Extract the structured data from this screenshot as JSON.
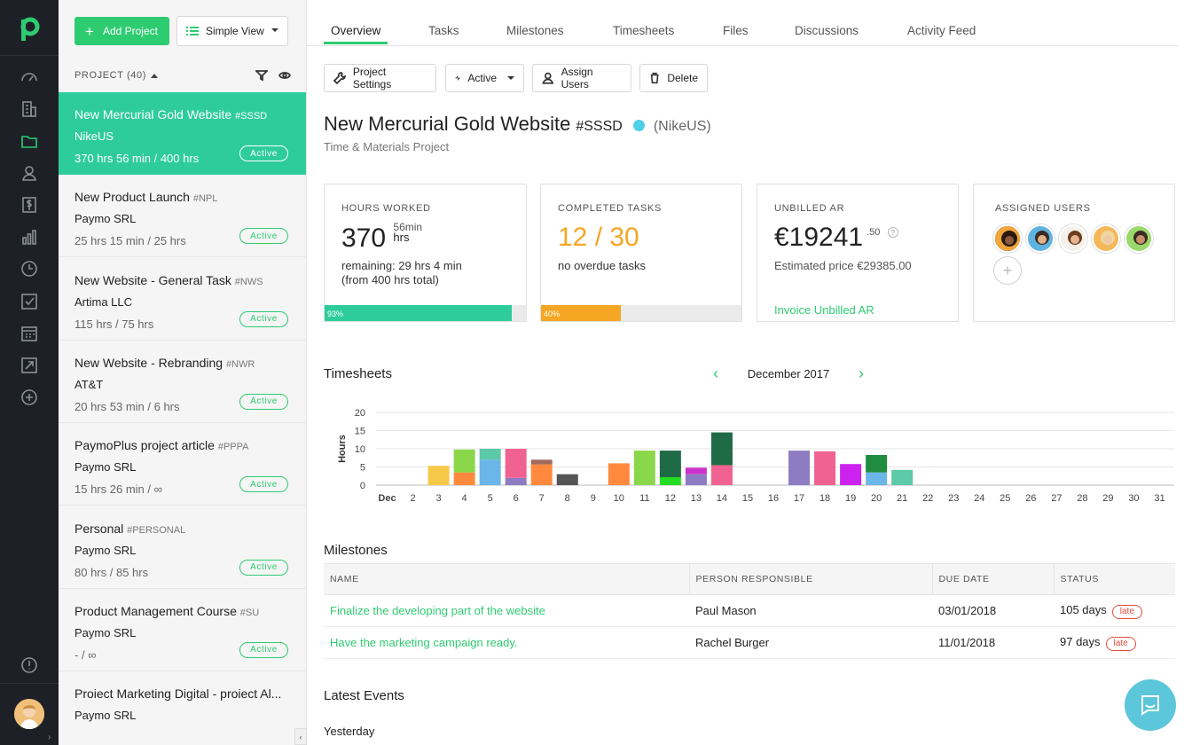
{
  "sidebar": {
    "icons": [
      "dashboard-icon",
      "clients-icon",
      "projects-icon",
      "users-icon",
      "invoices-icon",
      "reports-icon",
      "time-icon",
      "tasks-icon",
      "calendar-icon",
      "leads-icon",
      "add-icon",
      "help-icon"
    ]
  },
  "plist": {
    "add_label": "Add Project",
    "view_label": "Simple View",
    "header": "PROJECT (40)",
    "projects": [
      {
        "name": "New Mercurial Gold Website",
        "code": "#SSSD",
        "client": "NikeUS",
        "hours": "370 hrs 56 min / 400 hrs",
        "status": "Active"
      },
      {
        "name": "New Product Launch",
        "code": "#NPL",
        "client": "Paymo SRL",
        "hours": "25 hrs 15 min / 25 hrs",
        "status": "Active"
      },
      {
        "name": "New Website - General Task",
        "code": "#NWS",
        "client": "Artima LLC",
        "hours": "115 hrs / 75 hrs",
        "status": "Active"
      },
      {
        "name": "New Website - Rebranding",
        "code": "#NWR",
        "client": "AT&T",
        "hours": "20 hrs 53 min / 6 hrs",
        "status": "Active"
      },
      {
        "name": "PaymoPlus project article",
        "code": "#PPPA",
        "client": "Paymo SRL",
        "hours": "15 hrs 26 min / ∞",
        "status": "Active"
      },
      {
        "name": "Personal",
        "code": "#PERSONAL",
        "client": "Paymo SRL",
        "hours": "80 hrs / 85 hrs",
        "status": "Active"
      },
      {
        "name": "Product Management Course",
        "code": "#SU",
        "client": "Paymo SRL",
        "hours": "- / ∞",
        "status": "Active"
      },
      {
        "name": "Proiect Marketing Digital - proiect Al...",
        "code": "",
        "client": "Paymo SRL",
        "hours": "",
        "status": ""
      }
    ]
  },
  "tabs": [
    "Overview",
    "Tasks",
    "Milestones",
    "Timesheets",
    "Files",
    "Discussions",
    "Activity Feed"
  ],
  "toolbar": {
    "settings": "Project Settings",
    "status": "Active",
    "assign": "Assign Users",
    "delete": "Delete"
  },
  "project": {
    "title": "New Mercurial Gold Website",
    "code": "#SSSD",
    "client": "(NikeUS)",
    "type": "Time & Materials Project",
    "dot_color": "#4dd0e8"
  },
  "cards": {
    "hours": {
      "title": "HOURS WORKED",
      "value": "370",
      "unit_top": "56min",
      "unit_bottom": "hrs",
      "remaining": "remaining: 29 hrs 4 min",
      "total": "(from 400 hrs total)",
      "progress_label": "93%",
      "progress": 0.93,
      "color": "#2ecc9b"
    },
    "tasks": {
      "title": "COMPLETED TASKS",
      "value": "12 / 30",
      "note": "no overdue tasks",
      "progress_label": "40%",
      "progress": 0.4,
      "color": "#f5a623"
    },
    "ar": {
      "title": "UNBILLED AR",
      "value": "€19241",
      "cents": ".50",
      "estimate": "Estimated price €29385.00",
      "link": "Invoice Unbilled AR"
    },
    "users": {
      "title": "ASSIGNED USERS",
      "add": "+"
    }
  },
  "timesheets": {
    "title": "Timesheets",
    "month": "December 2017",
    "prev": "‹",
    "next": "›"
  },
  "chart_data": {
    "type": "bar",
    "stacked": true,
    "ylabel": "Hours",
    "ylim": [
      0,
      20
    ],
    "yticks": [
      0,
      5,
      10,
      15,
      20
    ],
    "categories": [
      "Dec",
      "2",
      "3",
      "4",
      "5",
      "6",
      "7",
      "8",
      "9",
      "10",
      "11",
      "12",
      "13",
      "14",
      "15",
      "16",
      "17",
      "18",
      "19",
      "20",
      "21",
      "22",
      "23",
      "24",
      "25",
      "26",
      "27",
      "28",
      "29",
      "30",
      "31"
    ],
    "stacks": [
      [],
      [],
      [
        {
          "v": 5.3,
          "c": "#f7c948"
        }
      ],
      [
        {
          "v": 3.5,
          "c": "#ff8a3d"
        },
        {
          "v": 6.3,
          "c": "#8bd74a"
        }
      ],
      [
        {
          "v": 7,
          "c": "#6bb6e8"
        },
        {
          "v": 3,
          "c": "#5cc9a7"
        }
      ],
      [
        {
          "v": 2,
          "c": "#8e7cc3"
        },
        {
          "v": 8,
          "c": "#f06292"
        }
      ],
      [
        {
          "v": 5.7,
          "c": "#ff8a3d"
        },
        {
          "v": 1.3,
          "c": "#a06a5a"
        }
      ],
      [
        {
          "v": 3,
          "c": "#555555"
        }
      ],
      [],
      [
        {
          "v": 6,
          "c": "#ff8a3d"
        }
      ],
      [
        {
          "v": 9.5,
          "c": "#8bd74a"
        }
      ],
      [
        {
          "v": 2.2,
          "c": "#22dd22"
        },
        {
          "v": 7.3,
          "c": "#1f6b45"
        }
      ],
      [
        {
          "v": 3,
          "c": "#8e7cc3"
        },
        {
          "v": 1.8,
          "c": "#cc33cc"
        }
      ],
      [
        {
          "v": 5.5,
          "c": "#f06292"
        },
        {
          "v": 9,
          "c": "#1f6b45"
        }
      ],
      [],
      [],
      [
        {
          "v": 9.5,
          "c": "#8e7cc3"
        }
      ],
      [
        {
          "v": 9.3,
          "c": "#f06292"
        }
      ],
      [
        {
          "v": 5.8,
          "c": "#cc22ee"
        }
      ],
      [
        {
          "v": 3.5,
          "c": "#6bb6e8"
        },
        {
          "v": 4.8,
          "c": "#1f8c3f"
        }
      ],
      [
        {
          "v": 4.2,
          "c": "#5cc9a7"
        }
      ],
      [],
      [],
      [],
      [],
      [],
      [],
      [],
      [],
      [],
      []
    ]
  },
  "milestones": {
    "title": "Milestones",
    "columns": [
      "NAME",
      "PERSON RESPONSIBLE",
      "DUE DATE",
      "STATUS"
    ],
    "rows": [
      {
        "name": "Finalize the developing part of the website",
        "person": "Paul Mason",
        "due": "03/01/2018",
        "days": "105 days",
        "status": "late"
      },
      {
        "name": "Have the marketing campaign ready.",
        "person": "Rachel Burger",
        "due": "11/01/2018",
        "days": "97 days",
        "status": "late"
      }
    ]
  },
  "events": {
    "title": "Latest Events",
    "group": "Yesterday"
  }
}
